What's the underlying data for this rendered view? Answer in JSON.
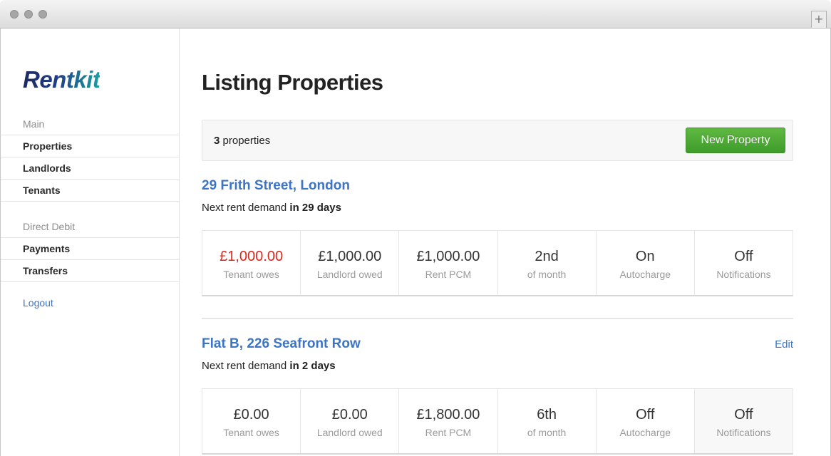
{
  "brand": {
    "logo": "Rentkit"
  },
  "sidebar": {
    "sections": [
      {
        "heading": "Main",
        "items": [
          "Properties",
          "Landlords",
          "Tenants"
        ]
      },
      {
        "heading": "Direct Debit",
        "items": [
          "Payments",
          "Transfers"
        ]
      }
    ],
    "logout": "Logout"
  },
  "page": {
    "title": "Listing Properties",
    "count_number": "3",
    "count_suffix": " properties",
    "new_button": "New Property"
  },
  "properties": [
    {
      "title": "29 Frith Street, London",
      "edit": "",
      "demand_prefix": "Next rent demand ",
      "demand_when": "in 29 days",
      "stats": [
        {
          "value": "£1,000.00",
          "label": "Tenant owes"
        },
        {
          "value": "£1,000.00",
          "label": "Landlord owed"
        },
        {
          "value": "£1,000.00",
          "label": "Rent PCM"
        },
        {
          "value": "2nd",
          "label": "of month"
        },
        {
          "value": "On",
          "label": "Autocharge"
        },
        {
          "value": "Off",
          "label": "Notifications"
        }
      ]
    },
    {
      "title": "Flat B, 226 Seafront Row",
      "edit": "Edit",
      "demand_prefix": "Next rent demand ",
      "demand_when": "in 2 days",
      "stats": [
        {
          "value": "£0.00",
          "label": "Tenant owes"
        },
        {
          "value": "£0.00",
          "label": "Landlord owed"
        },
        {
          "value": "£1,800.00",
          "label": "Rent PCM"
        },
        {
          "value": "6th",
          "label": "of month"
        },
        {
          "value": "Off",
          "label": "Autocharge"
        },
        {
          "value": "Off",
          "label": "Notifications"
        }
      ]
    }
  ],
  "colors": {
    "accent": "#3d74c4",
    "primary_button": "#4fab36",
    "negative": "#e0261b"
  }
}
